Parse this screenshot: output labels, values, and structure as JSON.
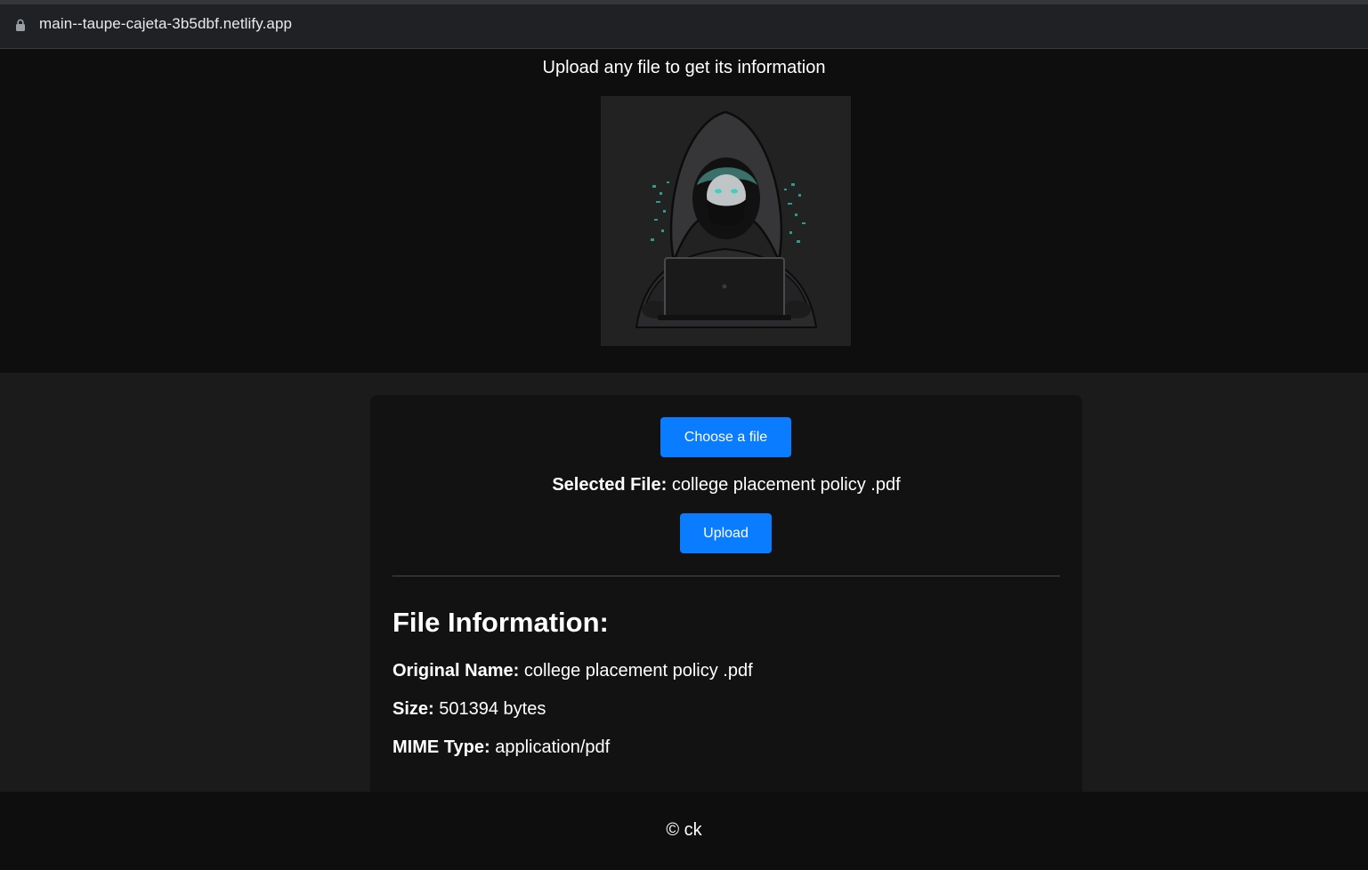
{
  "browser": {
    "url": "main--taupe-cajeta-3b5dbf.netlify.app"
  },
  "hero": {
    "title": "Upload any file to get its information",
    "image_icon": "hooded-hacker-laptop-illustration"
  },
  "uploader": {
    "choose_label": "Choose a file",
    "selected_label": "Selected File:",
    "selected_value": "college placement policy .pdf",
    "upload_label": "Upload"
  },
  "file_info": {
    "heading": "File Information:",
    "name_label": "Original Name:",
    "name_value": "college placement policy .pdf",
    "size_label": "Size:",
    "size_value": "501394 bytes",
    "mime_label": "MIME Type:",
    "mime_value": "application/pdf"
  },
  "footer": {
    "text": "© ck"
  },
  "colors": {
    "accent": "#0a7cff",
    "page_bg": "#1b1b1c",
    "hero_bg": "#0e0e0e",
    "card_bg": "#121213",
    "teal": "#3fd1c0"
  }
}
